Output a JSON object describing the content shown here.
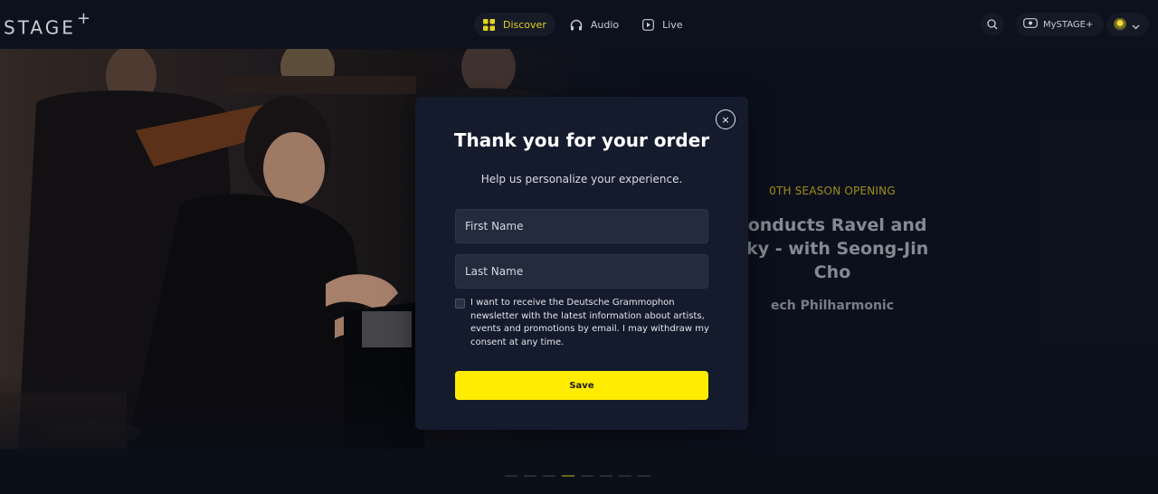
{
  "header": {
    "logo_text": "STAGE",
    "logo_plus": "+",
    "nav": [
      {
        "label": "Discover",
        "icon": "grid-icon",
        "active": true
      },
      {
        "label": "Audio",
        "icon": "headphones-icon",
        "active": false
      },
      {
        "label": "Live",
        "icon": "play-icon",
        "active": false
      }
    ],
    "mystage_label": "MySTAGE+"
  },
  "hero": {
    "kicker": "0TH SEASON OPENING",
    "title_line1": "conducts Ravel and",
    "title_line2": "sky - with Seong-Jin",
    "title_line3": "Cho",
    "subtitle": "ech Philharmonic"
  },
  "modal": {
    "title": "Thank you for your order",
    "subtitle": "Help us personalize your experience.",
    "first_name_placeholder": "First Name",
    "last_name_placeholder": "Last Name",
    "consent_text": "I want to receive the Deutsche Grammophon newsletter with the latest information about artists, events and promotions by email. I may withdraw my consent at any time.",
    "consent_checked": false,
    "save_label": "Save",
    "close_symbol": "×"
  },
  "carousel": {
    "slide_count": 8,
    "active_index": 3
  },
  "colors": {
    "accent": "#ffec00",
    "nav_active": "#e3d21f",
    "modal_bg": "#141b2d",
    "page_bg": "#0b0f19"
  }
}
